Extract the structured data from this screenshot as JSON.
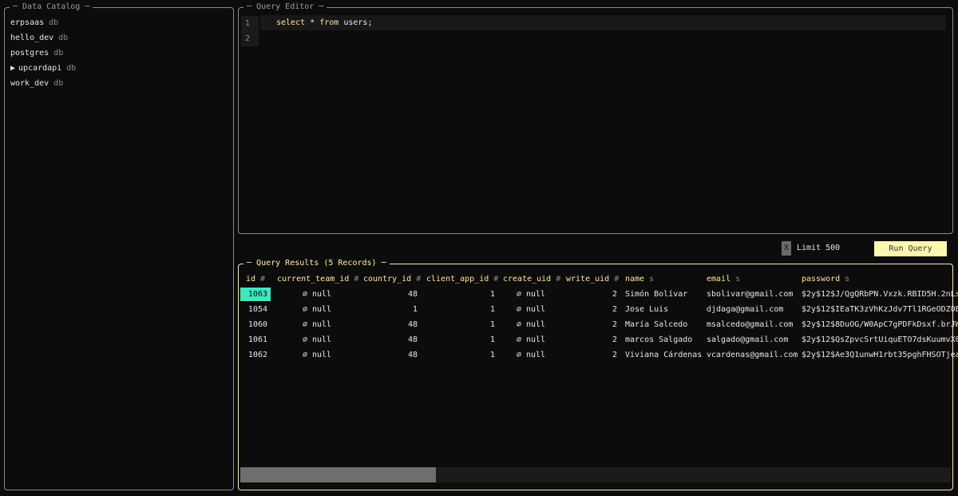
{
  "catalog": {
    "title": "Data Catalog",
    "items": [
      {
        "name": "erpsaas",
        "type": "db",
        "arrow": ""
      },
      {
        "name": "hello_dev",
        "type": "db",
        "arrow": ""
      },
      {
        "name": "postgres",
        "type": "db",
        "arrow": ""
      },
      {
        "name": "upcardapi",
        "type": "db",
        "arrow": "▶"
      },
      {
        "name": "work_dev",
        "type": "db",
        "arrow": ""
      }
    ]
  },
  "editor": {
    "title": "Query Editor",
    "line_numbers": [
      "1",
      "2"
    ],
    "query": {
      "kw1": "select",
      "op": "*",
      "kw2": "from",
      "table": "users;"
    }
  },
  "toolbar": {
    "limit_toggle": "X",
    "limit_label": "Limit 500",
    "run_label": "Run Query"
  },
  "results": {
    "title": "Query Results (5 Records)",
    "columns": [
      {
        "name": "id",
        "type": "#"
      },
      {
        "name": "current_team_id",
        "type": "#"
      },
      {
        "name": "country_id",
        "type": "#"
      },
      {
        "name": "client_app_id",
        "type": "#"
      },
      {
        "name": "create_uid",
        "type": "#"
      },
      {
        "name": "write_uid",
        "type": "#"
      },
      {
        "name": "name",
        "type": "s"
      },
      {
        "name": "email",
        "type": "s"
      },
      {
        "name": "password",
        "type": "s"
      }
    ],
    "rows": [
      [
        "1063",
        "⌀ null",
        "48",
        "1",
        "⌀ null",
        "2",
        "Simón Bolívar",
        "sbolivar@gmail.com",
        "$2y$12$J/QgQRbPN.Vxzk.RBID5H.2nLs"
      ],
      [
        "1054",
        "⌀ null",
        "1",
        "1",
        "⌀ null",
        "2",
        "Jose Luis",
        "djdaga@gmail.com",
        "$2y$12$IEaTK3zVhKzJdv7Tl1RGeODZ0B"
      ],
      [
        "1060",
        "⌀ null",
        "48",
        "1",
        "⌀ null",
        "2",
        "María Salcedo",
        "msalcedo@gmail.com",
        "$2y$12$8DuOG/W0ApC7gPDFkDsxf.brJW"
      ],
      [
        "1061",
        "⌀ null",
        "48",
        "1",
        "⌀ null",
        "2",
        "marcos Salgado",
        "salgado@gmail.com",
        "$2y$12$QsZpvcSrtUiquETO7dsKuumvX0"
      ],
      [
        "1062",
        "⌀ null",
        "48",
        "1",
        "⌀ null",
        "2",
        "Viviana Cárdenas",
        "vcardenas@gmail.com",
        "$2y$12$Ae3Q1unwH1rbt35pghFHSOTjea"
      ]
    ],
    "selected_cell": "1063"
  },
  "colors": {
    "accent_yellow": "#ffe69a",
    "selection": "#3fe8c0",
    "border": "#8a8a8a"
  }
}
